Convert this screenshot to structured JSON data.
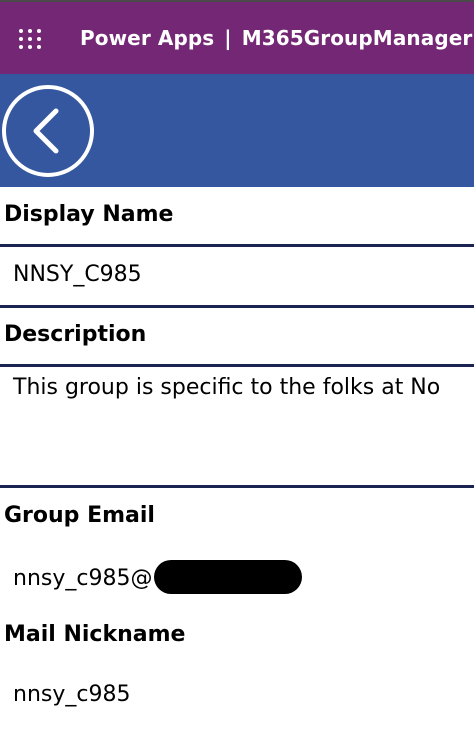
{
  "app_bar": {
    "product": "Power Apps",
    "separator": "|",
    "app_name": "M365GroupManager"
  },
  "header": {
    "back_icon": "chevron-left-icon"
  },
  "fields": {
    "display_name": {
      "label": "Display Name",
      "value": "NNSY_C985"
    },
    "description": {
      "label": "Description",
      "value": "This group is specific to the folks at No"
    },
    "group_email": {
      "label": "Group Email",
      "value_prefix": "nnsy_c985@"
    },
    "mail_nickname": {
      "label": "Mail Nickname",
      "value": "nnsy_c985"
    }
  },
  "colors": {
    "app_bar": "#742774",
    "header": "#3557a0",
    "rule": "#1b2350"
  }
}
